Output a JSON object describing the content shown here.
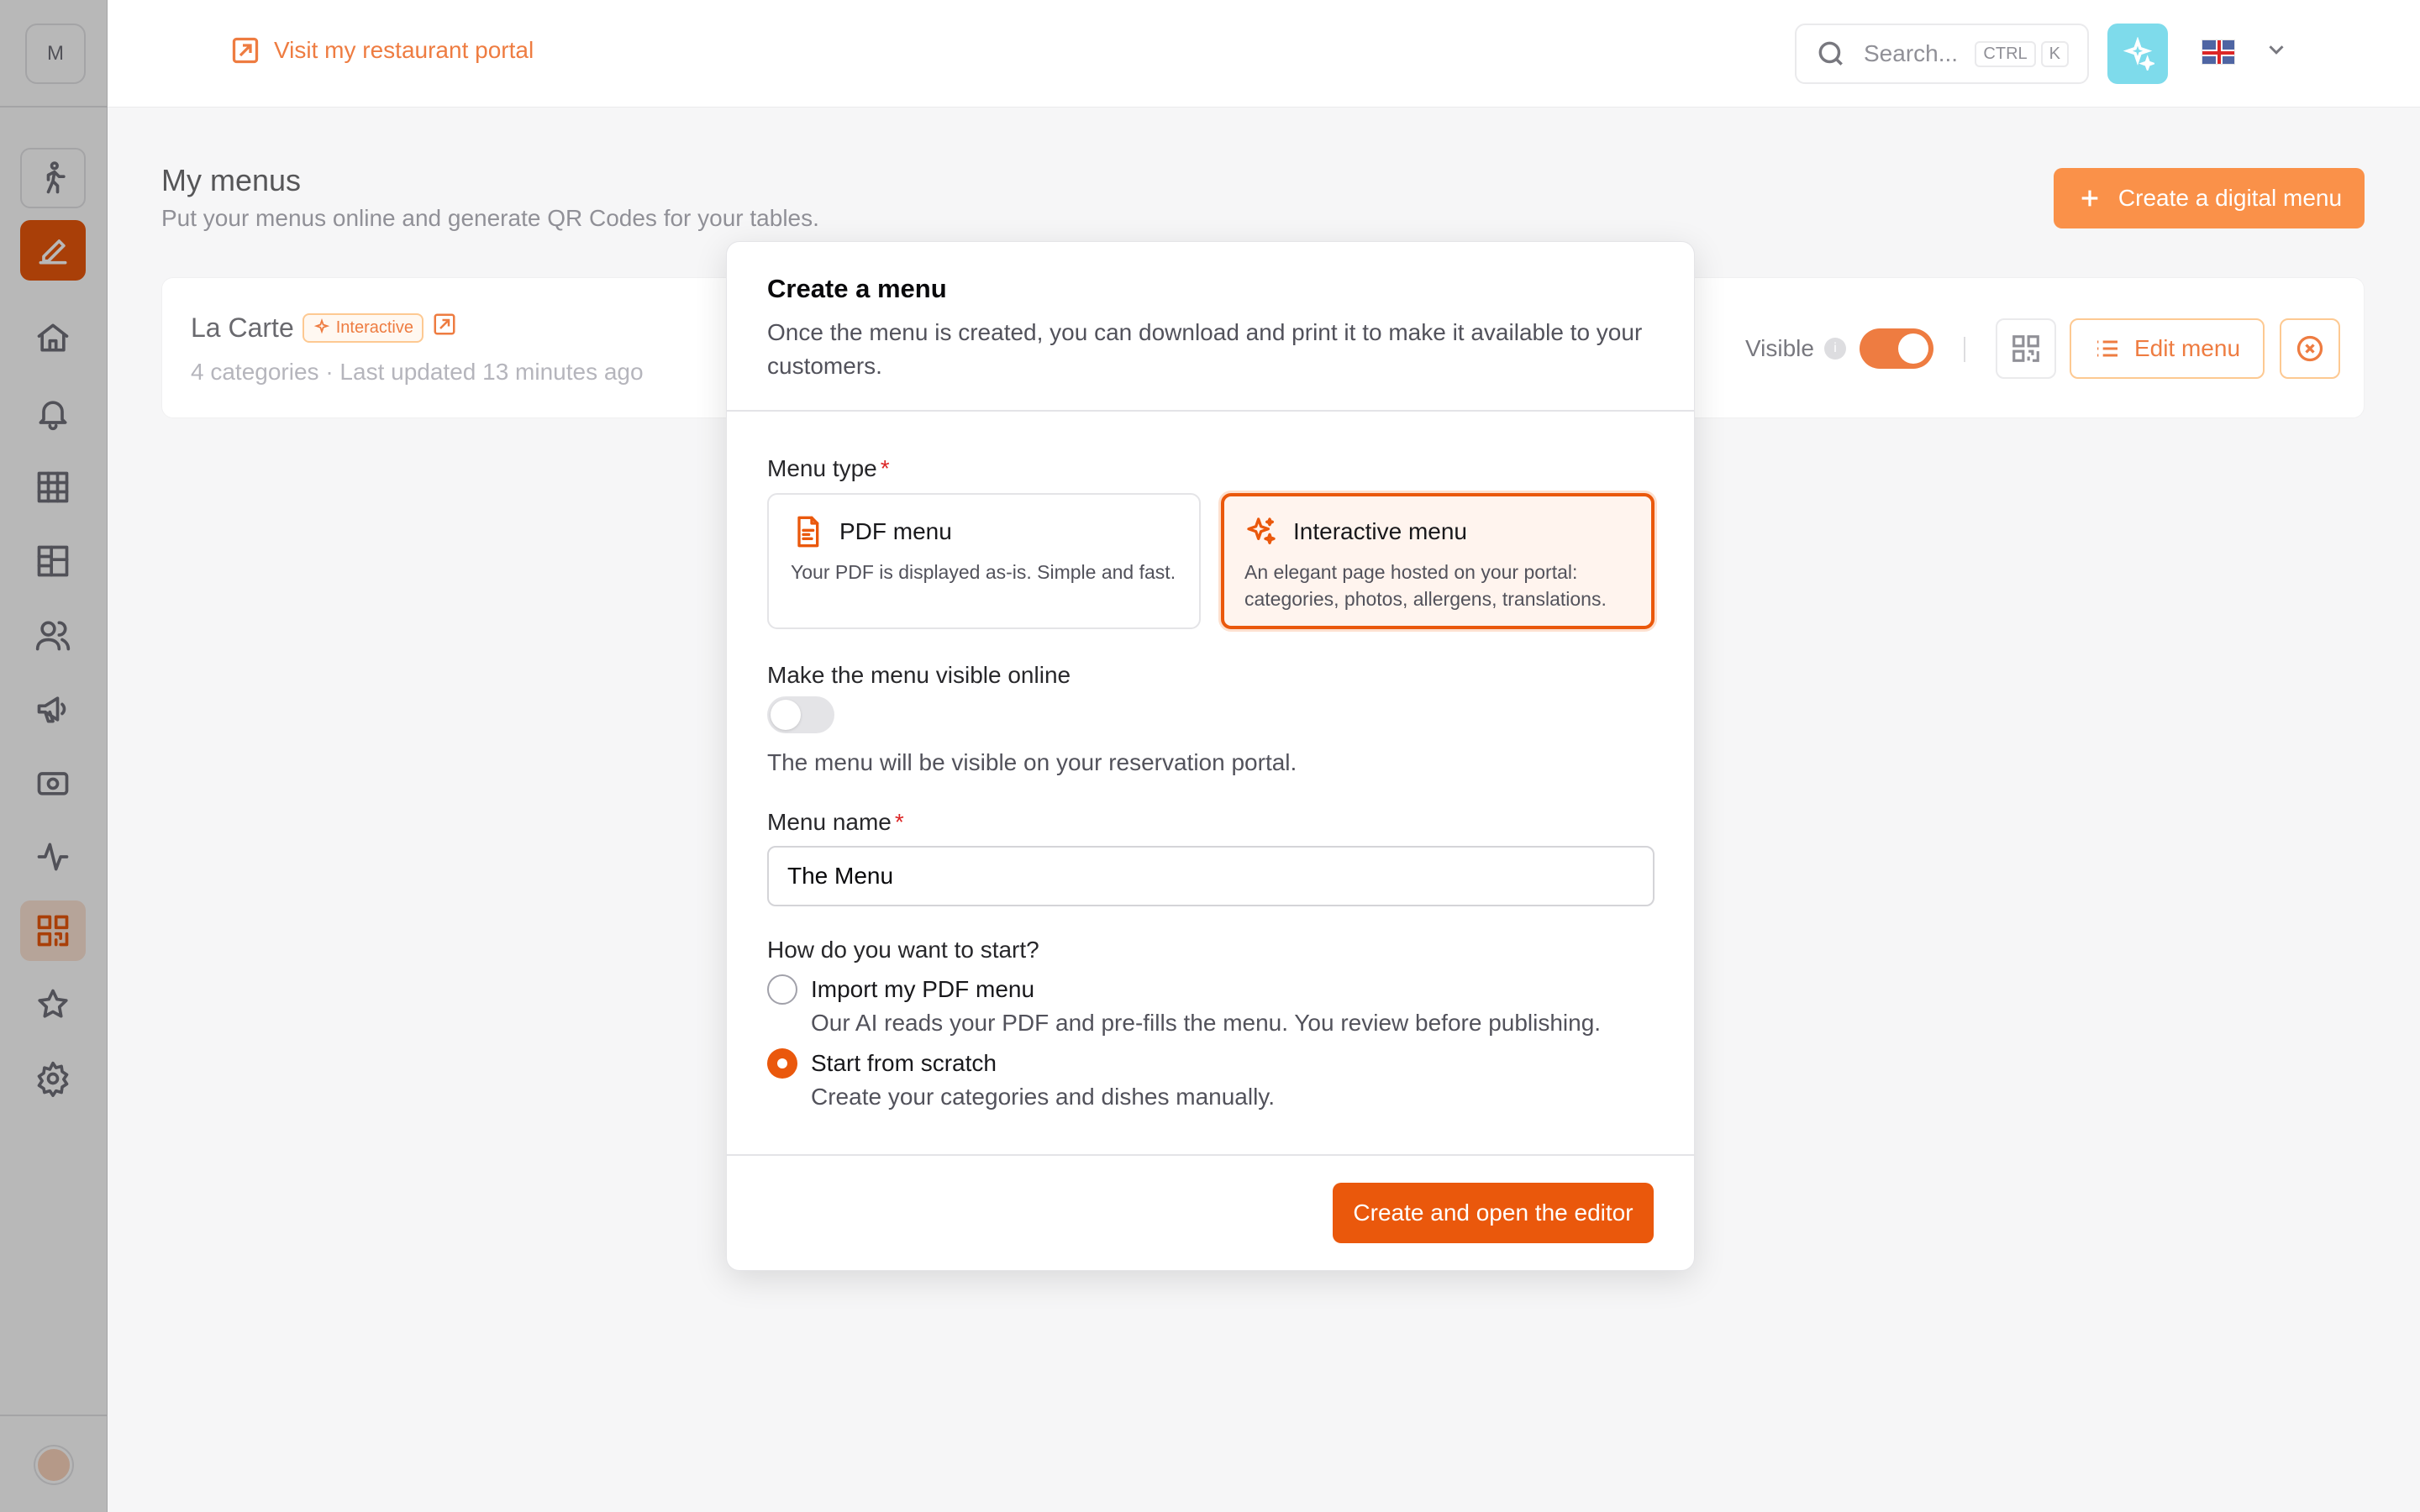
{
  "sidebar": {
    "logo_letter": "M",
    "icons": [
      "walking-icon",
      "edit-icon",
      "home-icon",
      "bell-icon",
      "grid-icon",
      "layout-icon",
      "users-icon",
      "megaphone-icon",
      "camera-icon",
      "activity-icon",
      "qr-code-icon",
      "star-icon",
      "gear-icon"
    ]
  },
  "topbar": {
    "portal_link": "Visit my restaurant portal",
    "search_placeholder": "Search...",
    "kbd_ctrl": "CTRL",
    "kbd_k": "K"
  },
  "page": {
    "title": "My menus",
    "subtitle": "Put your menus online and generate QR Codes for your tables.",
    "create_button": "Create a digital menu",
    "menu_card": {
      "name": "La Carte",
      "badge": "Interactive",
      "meta": "4 categories · Last updated 13 minutes ago",
      "visible_label": "Visible",
      "visible_on": true,
      "edit_button": "Edit menu"
    }
  },
  "modal": {
    "title": "Create a menu",
    "description": "Once the menu is created, you can download and print it to make it available to your customers.",
    "menu_type_label": "Menu type",
    "required_mark": "*",
    "options": [
      {
        "title": "PDF menu",
        "desc": "Your PDF is displayed as-is. Simple and fast.",
        "icon": "document-icon",
        "selected": false
      },
      {
        "title": "Interactive menu",
        "desc": "An elegant page hosted on your portal: categories, photos, allergens, translations.",
        "icon": "sparkles-icon",
        "selected": true
      }
    ],
    "visible_label": "Make the menu visible online",
    "visible_on": false,
    "visible_help": "The menu will be visible on your reservation portal.",
    "name_label": "Menu name",
    "name_value": "The Menu",
    "start_label": "How do you want to start?",
    "start_options": [
      {
        "title": "Import my PDF menu",
        "desc": "Our AI reads your PDF and pre-fills the menu. You review before publishing.",
        "checked": false
      },
      {
        "title": "Start from scratch",
        "desc": "Create your categories and dishes manually.",
        "checked": true
      }
    ],
    "submit": "Create and open the editor"
  },
  "colors": {
    "accent": "#ea580c",
    "ai_button": "#5ad1e6"
  }
}
